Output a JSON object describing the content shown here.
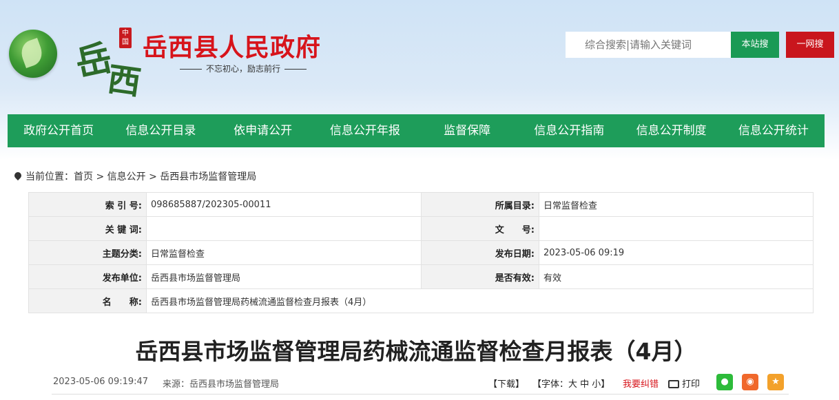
{
  "header": {
    "seal": "中国",
    "calligraphy_1": "岳",
    "calligraphy_2": "西",
    "site_title": "岳西县人民政府",
    "slogan": "不忘初心，励志前行",
    "search_placeholder": "综合搜索|请输入关键词",
    "btn_site": "本站搜",
    "btn_all": "一网搜"
  },
  "nav": [
    "政府公开首页",
    "信息公开目录",
    "依申请公开",
    "信息公开年报",
    "监督保障",
    "信息公开指南",
    "信息公开制度",
    "信息公开统计"
  ],
  "breadcrumb": {
    "prefix": "当前位置：",
    "items": [
      "首页",
      "信息公开",
      "岳西县市场监督管理局"
    ],
    "sep": " > "
  },
  "meta": {
    "index_label": "索 引 号:",
    "index_value": "098685887/202305-00011",
    "catalog_label": "所属目录:",
    "catalog_value": "日常监督检查",
    "keywords_label": "关 键 词:",
    "keywords_value": "",
    "docno_label": "文　　号:",
    "docno_value": "",
    "topic_label": "主题分类:",
    "topic_value": "日常监督检查",
    "pubdate_label": "发布日期:",
    "pubdate_value": "2023-05-06 09:19",
    "unit_label": "发布单位:",
    "unit_value": "岳西县市场监督管理局",
    "valid_label": "是否有效:",
    "valid_value": "有效",
    "name_label": "名　　称:",
    "name_value": "岳西县市场监督管理局药械流通监督检查月报表（4月）"
  },
  "article": {
    "title": "岳西县市场监督管理局药械流通监督检查月报表（4月）",
    "datetime": "2023-05-06 09:19:47",
    "source": "来源：岳西县市场监督管理局",
    "download": "【下载】",
    "font": "【字体：大 中 小】",
    "error": "我要纠错",
    "print": "打印"
  },
  "colors": {
    "brand_green": "#1e9d5a",
    "brand_red": "#d7141b"
  }
}
